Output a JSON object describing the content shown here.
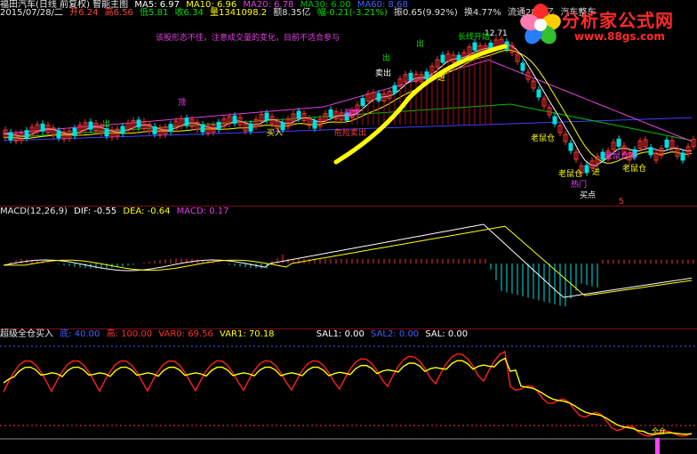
{
  "header_line1": {
    "title": "福田汽车(日线 前复权) 智能主图",
    "ma5": "MA5: 6.97",
    "ma10": "MA10: 6.96",
    "ma20": "MA20: 6.78",
    "ma30": "MA30: 6.00",
    "ma60": "MA60: 8.68"
  },
  "header_line2": {
    "date": "2015/07/28/二",
    "open": "开6.24",
    "high": "高6.56",
    "low": "低5.81",
    "close": "收6.34",
    "volume": "量1341098.2",
    "amount": "额8.35亿",
    "change": "幅-0.21(-3.21%)",
    "amplitude": "振0.65(9.92%)",
    "turnover": "换4.77%",
    "float_cap": "流通28.1亿",
    "sector": "汽车整车"
  },
  "note": "该股形态不佳，注意成交量的变化，目前不适合参与",
  "macd_header": {
    "name": "MACD(12,26,9)",
    "dif": "DIF: -0.55",
    "dea": "DEA: -0.64",
    "macd": "MACD: 0.17"
  },
  "osc_header": {
    "name": "超级全仓买入",
    "low": "底: 40.00",
    "high": "高: 100.00",
    "var0": "VAR0: 69.56",
    "var1": "VAR1: 70.18",
    "sal1": "SAL1: 0.00",
    "sal2": "SAL2: 0.00",
    "sal": "SAL: 0.00"
  },
  "chart_labels": {
    "top_price": "12.71",
    "low_price": "5",
    "signal_buy": "买入",
    "signal_sell": "卖出",
    "signal_enter": "进",
    "signal_out": "出",
    "signal_long_start": "长线开始",
    "signal_short": "短线卖出",
    "signal_danger": "危险卖出",
    "signal_old_rat": "老鼠仓",
    "signal_old_rat_store": "老鼠仓库",
    "signal_hot": "热门",
    "signal_strong": "强势",
    "signal_bottom": "大底",
    "signal_buy_point": "买点",
    "signal_full": "全仓",
    "signal_top": "顶"
  },
  "logo": {
    "name": "分析家公式网",
    "url": "www.88gs.com"
  },
  "colors": {
    "background": "#000000",
    "up": "#ff3030",
    "down": "#00e0e0",
    "ma5": "#ffffff",
    "ma10": "#ffff00",
    "ma20": "#e040e0",
    "ma30": "#00c000",
    "ma60": "#4040ff",
    "separator": "#7a1010",
    "trend_marker": "#ffff00"
  }
}
